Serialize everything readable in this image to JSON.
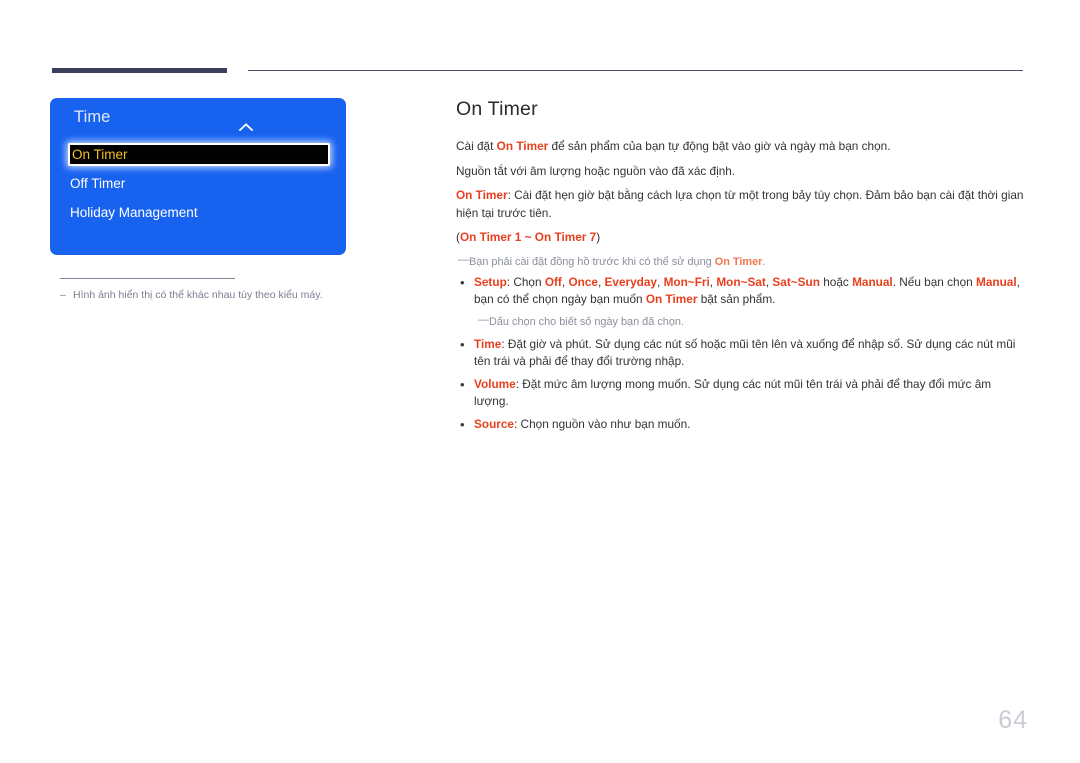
{
  "page": {
    "number": "64"
  },
  "osd": {
    "title": "Time",
    "caret_icon": "chevron-up-icon",
    "items": [
      {
        "label": "On Timer",
        "selected": true
      },
      {
        "label": "Off Timer",
        "selected": false
      },
      {
        "label": "Holiday Management",
        "selected": false
      }
    ],
    "footnote": {
      "dash": "–",
      "text": "Hình ảnh hiển thị có thể khác nhau tùy theo kiểu máy."
    },
    "colors": {
      "panel_blue": "#1862f0",
      "selected_bg": "#000000",
      "selected_text": "#f2c021"
    }
  },
  "content": {
    "title": "On Timer",
    "paragraphs": [
      {
        "parts": [
          {
            "t": "Cài đặt ",
            "k": false
          },
          {
            "t": "On Timer",
            "k": true
          },
          {
            "t": " để sản phẩm của bạn tự động bật vào giờ và ngày mà bạn chọn.",
            "k": false
          }
        ]
      },
      {
        "parts": [
          {
            "t": "Nguồn tắt với âm lượng hoặc nguồn vào đã xác định.",
            "k": false
          }
        ]
      },
      {
        "parts": [
          {
            "t": "On Timer",
            "k": true
          },
          {
            "t": ": Cài đặt hẹn giờ bật bằng cách lựa chọn từ một trong bảy tùy chọn. Đảm bảo bạn cài đặt thời gian hiện tại trước tiên.",
            "k": false
          }
        ]
      },
      {
        "parts": [
          {
            "t": "(",
            "k": false
          },
          {
            "t": "On Timer 1 ~ On Timer 7",
            "k": true
          },
          {
            "t": ")",
            "k": false
          }
        ]
      }
    ],
    "top_note": {
      "dash": "—",
      "parts": [
        {
          "t": "Bạn phải cài đặt đồng hồ trước khi có thể sử dụng ",
          "k": false
        },
        {
          "t": "On Timer",
          "k": true
        },
        {
          "t": ".",
          "k": false
        }
      ]
    },
    "bullets": [
      {
        "dot": "•",
        "parts": [
          {
            "t": "Setup",
            "k": true
          },
          {
            "t": ": Chọn ",
            "k": false
          },
          {
            "t": "Off",
            "k": true
          },
          {
            "t": ", ",
            "k": false
          },
          {
            "t": "Once",
            "k": true
          },
          {
            "t": ", ",
            "k": false
          },
          {
            "t": "Everyday",
            "k": true
          },
          {
            "t": ", ",
            "k": false
          },
          {
            "t": "Mon~Fri",
            "k": true
          },
          {
            "t": ", ",
            "k": false
          },
          {
            "t": "Mon~Sat",
            "k": true
          },
          {
            "t": ", ",
            "k": false
          },
          {
            "t": "Sat~Sun",
            "k": true
          },
          {
            "t": " hoặc ",
            "k": false
          },
          {
            "t": "Manual",
            "k": true
          },
          {
            "t": ". Nếu bạn chọn ",
            "k": false
          },
          {
            "t": "Manual",
            "k": true
          },
          {
            "t": ", bạn có thể chọn ngày bạn muốn ",
            "k": false
          },
          {
            "t": "On Timer",
            "k": true
          },
          {
            "t": " bật sản phẩm.",
            "k": false
          }
        ],
        "sub_note": {
          "dash": "—",
          "text": "Dấu chọn cho biết số ngày bạn đã chọn."
        }
      },
      {
        "dot": "•",
        "parts": [
          {
            "t": "Time",
            "k": true
          },
          {
            "t": ": Đặt giờ và phút. Sử dụng các nút số hoặc mũi tên lên và xuống để nhập số. Sử dụng các nút mũi tên trái và phải để thay đổi trường nhập.",
            "k": false
          }
        ]
      },
      {
        "dot": "•",
        "parts": [
          {
            "t": "Volume",
            "k": true
          },
          {
            "t": ": Đặt mức âm lượng mong muốn. Sử dụng các nút mũi tên trái và phải để thay đổi mức âm lượng.",
            "k": false
          }
        ]
      },
      {
        "dot": "•",
        "parts": [
          {
            "t": "Source",
            "k": true
          },
          {
            "t": ": Chọn nguồn vào như bạn muốn.",
            "k": false
          }
        ]
      }
    ]
  }
}
